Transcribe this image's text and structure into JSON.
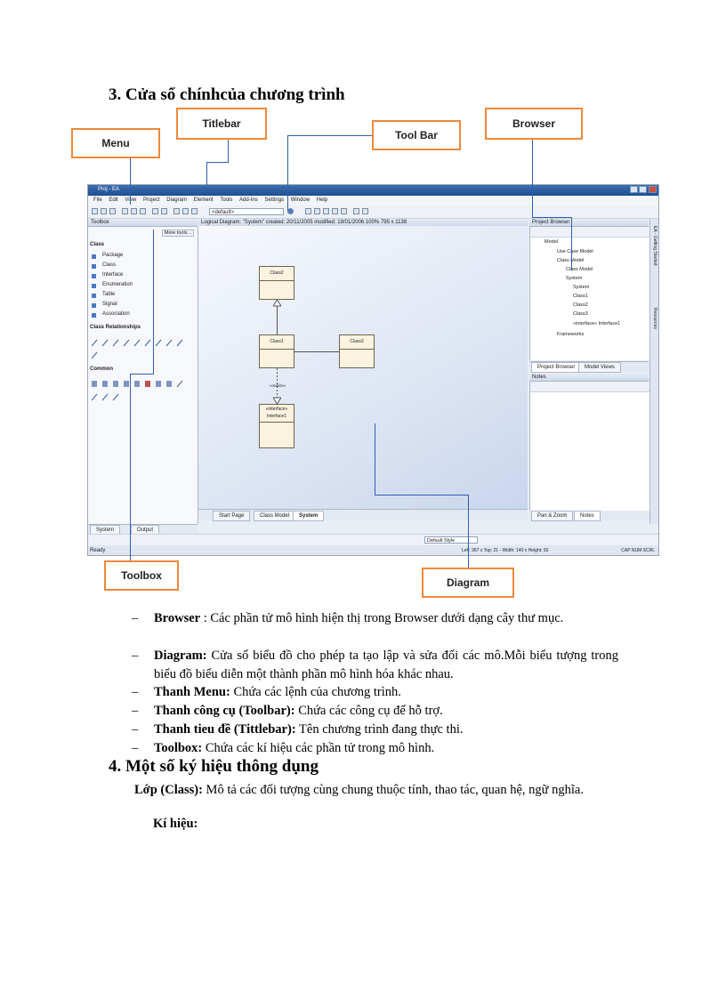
{
  "section3_title": "3. Cửa sổ chínhcủa chương trình",
  "callouts": {
    "titlebar": "Titlebar",
    "menu": "Menu",
    "toolbar": "Tool Bar",
    "browser": "Browser",
    "toolbox": "Toolbox",
    "diagram": "Diagram"
  },
  "screenshot": {
    "window_title": "Proj - EA",
    "menu": [
      "File",
      "Edit",
      "View",
      "Project",
      "Diagram",
      "Element",
      "Tools",
      "Add-Ins",
      "Settings",
      "Window",
      "Help"
    ],
    "toolbar_default": "<default>",
    "toolbox_header": "Toolbox",
    "toolbox_more": "More tools...",
    "toolbox_sections": {
      "class": "Class",
      "class_items": [
        "Package",
        "Class",
        "Interface",
        "Enumeration",
        "Table",
        "Signal",
        "Association"
      ],
      "relationships": "Class Relationships",
      "common": "Common"
    },
    "diagram_header": "Logical Diagram: \"System\"  created: 20/11/2005  modified: 19/01/2006  100%  795 x 1138",
    "classes": [
      "Class2",
      "Class1",
      "Class3",
      "«interface» Interface1"
    ],
    "interface_label": "«realize»",
    "diagram_tabs": [
      "Start Page",
      "Class Model",
      "System"
    ],
    "browser_header": "Project Browser",
    "browser_tree": [
      "Model",
      "Use Case Model",
      "Class Model",
      "Class Model",
      "System",
      "System",
      "Class1",
      "Class2",
      "Class3",
      "«interface» Interface1",
      "Frameworks"
    ],
    "browser_tabs": [
      "Project Browser",
      "Model Views"
    ],
    "notes_header": "Notes",
    "notes_tabs": [
      "Pan & Zoom",
      "Notes"
    ],
    "bottom_tabs": [
      "System",
      "Output"
    ],
    "style_select": "Default Style",
    "status_ready": "Ready",
    "status_coords": "Left: 367 x Top: 21 - Width: 140 x Height: 92",
    "status_keys": "CAP NUM SCRL",
    "right_sidebar": [
      "EA - Getting Started",
      "Resources"
    ]
  },
  "bullets": [
    {
      "term": "Browser",
      "sep": " : ",
      "text": "Các phần tử mô hình hiện thị trong Browser dưới dạng cây thư mục."
    },
    {
      "term": "Diagram:",
      "sep": " ",
      "text": "Cửa sổ biểu đồ cho phép ta tạo lập và sửa đổi các mô.Mỗi biểu tượng trong biểu đồ biểu diễn một thành phần mô hình hóa khác nhau."
    },
    {
      "term": "Thanh Menu:",
      "sep": " ",
      "text": "Chứa các lệnh của chương trình."
    },
    {
      "term": "Thanh công cụ (Toolbar):",
      "sep": " ",
      "text": "Chứa các công cụ để hỗ trợ."
    },
    {
      "term": "Thanh tieu đề (Tittlebar):",
      "sep": " ",
      "text": "Tên chương trình đang thực thi."
    },
    {
      "term": "Toolbox:",
      "sep": " ",
      "text": "Chứa các kí hiệu các phần tử trong mô hình."
    }
  ],
  "bullet_dash": "–",
  "section4_title": "4. Một số ký hiệu thông dụng",
  "class_para": {
    "term": "Lớp (Class):",
    "text": " Mô tả các đối tượng cùng chung thuộc tính, thao tác, quan hệ, ngữ nghĩa."
  },
  "kihieu": "Kí hiệu:"
}
